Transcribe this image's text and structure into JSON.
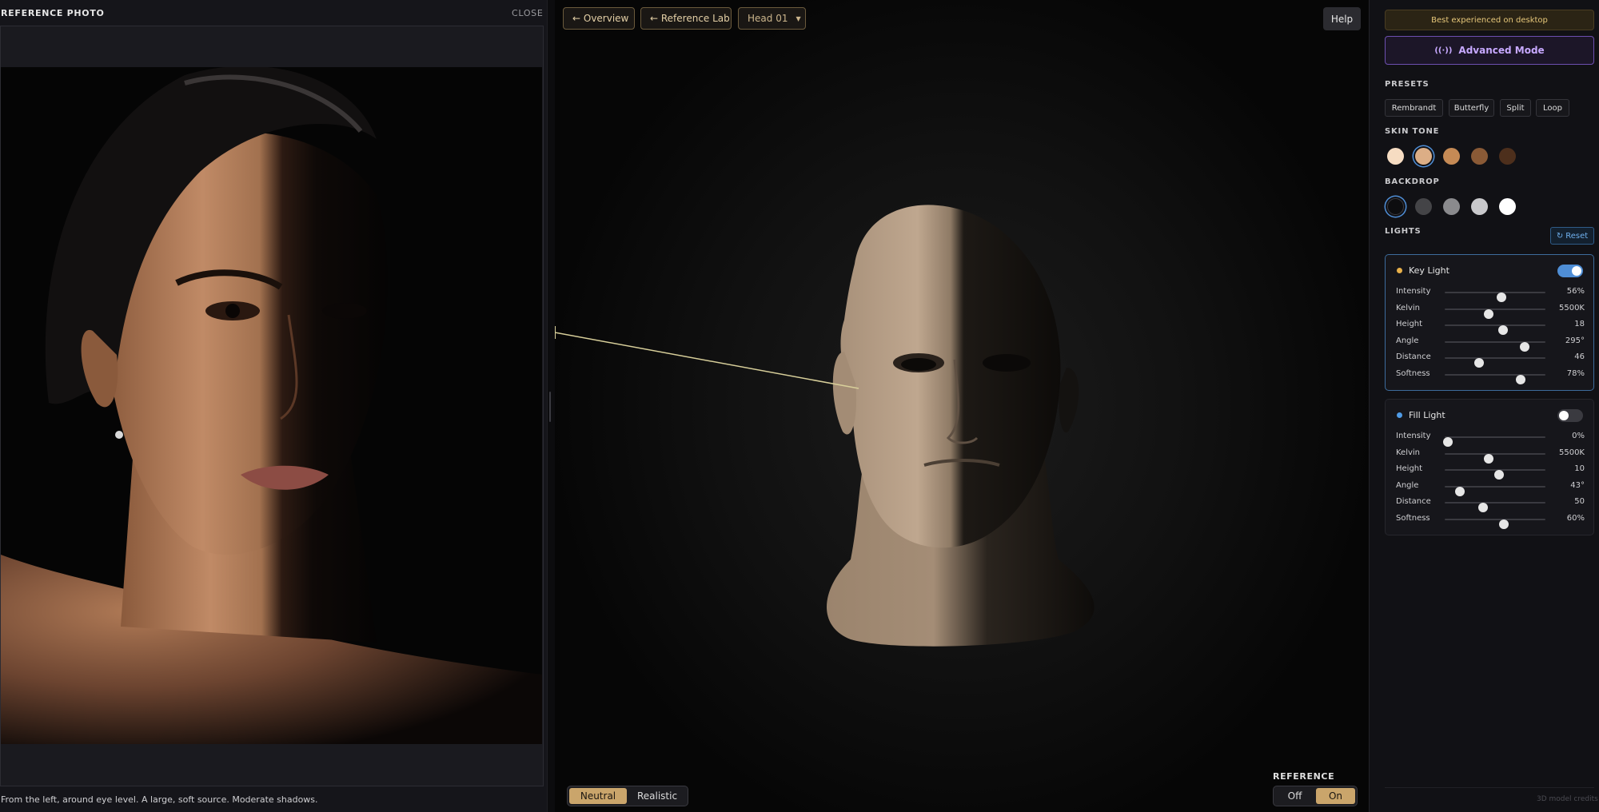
{
  "reference_panel": {
    "title": "REFERENCE PHOTO",
    "close_label": "CLOSE",
    "caption": "From the left, around eye level. A large, soft source. Moderate shadows."
  },
  "viewport": {
    "nav": {
      "overview_label": "← Overview",
      "reference_lab_label": "← Reference Lab",
      "head_select_label": "Head 01",
      "help_label": "Help"
    },
    "render_mode": {
      "options": [
        "Neutral",
        "Realistic"
      ],
      "selected": "Neutral"
    },
    "reference_toggle": {
      "label": "REFERENCE",
      "options": [
        "Off",
        "On"
      ],
      "selected": "On"
    }
  },
  "sidebar": {
    "desktop_note": "Best experienced on desktop",
    "advanced_mode_label": "Advanced Mode",
    "presets_label": "PRESETS",
    "presets": [
      "Rembrandt",
      "Butterfly",
      "Split",
      "Loop"
    ],
    "skin_tone_label": "SKIN TONE",
    "skin_tones": [
      "#f6dcc2",
      "#dcae86",
      "#c58a55",
      "#8a5a36",
      "#4d2f1c"
    ],
    "skin_tone_selected": 1,
    "backdrop_label": "BACKDROP",
    "backdrops": [
      "#0d0d0f",
      "#444447",
      "#8a8a8d",
      "#c9c9cc",
      "#ffffff"
    ],
    "backdrop_selected": 0,
    "lights_label": "LIGHTS",
    "reset_label": "Reset",
    "lights": [
      {
        "name": "Key Light",
        "dot_color": "#e8b04a",
        "enabled": true,
        "sliders": [
          {
            "label": "Intensity",
            "value": "56%",
            "position": 0.56
          },
          {
            "label": "Kelvin",
            "value": "5500K",
            "position": 0.44
          },
          {
            "label": "Height",
            "value": "18",
            "position": 0.58
          },
          {
            "label": "Angle",
            "value": "295°",
            "position": 0.79
          },
          {
            "label": "Distance",
            "value": "46",
            "position": 0.34
          },
          {
            "label": "Softness",
            "value": "78%",
            "position": 0.75
          }
        ]
      },
      {
        "name": "Fill Light",
        "dot_color": "#4f9be6",
        "enabled": false,
        "sliders": [
          {
            "label": "Intensity",
            "value": "0%",
            "position": 0.03
          },
          {
            "label": "Kelvin",
            "value": "5500K",
            "position": 0.44
          },
          {
            "label": "Height",
            "value": "10",
            "position": 0.54
          },
          {
            "label": "Angle",
            "value": "43°",
            "position": 0.15
          },
          {
            "label": "Distance",
            "value": "50",
            "position": 0.38
          },
          {
            "label": "Softness",
            "value": "60%",
            "position": 0.59
          }
        ]
      }
    ],
    "credits": "3D model credits"
  }
}
